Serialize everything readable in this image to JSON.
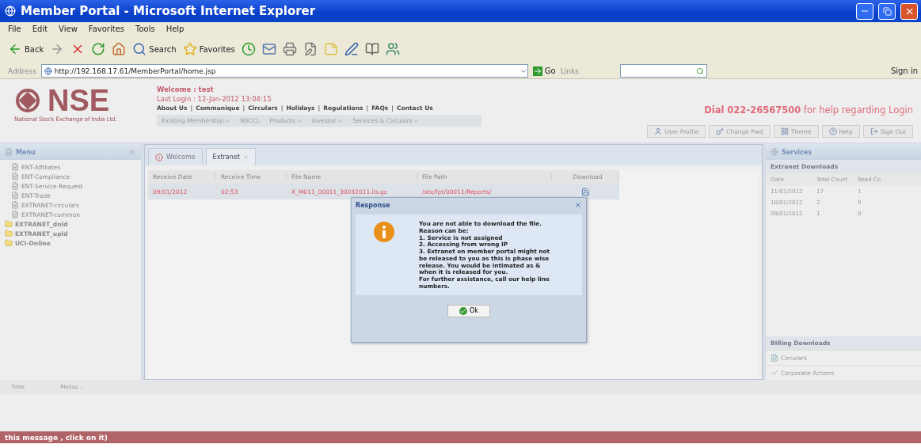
{
  "window": {
    "title": "Member Portal - Microsoft Internet Explorer"
  },
  "menu_bar": [
    "File",
    "Edit",
    "View",
    "Favorites",
    "Tools",
    "Help"
  ],
  "toolbar": [
    {
      "kind": "back",
      "label": "Back"
    },
    {
      "kind": "forward"
    },
    {
      "kind": "stop"
    },
    {
      "kind": "refresh"
    },
    {
      "kind": "home"
    },
    {
      "kind": "search",
      "label": "Search"
    },
    {
      "kind": "favorites",
      "label": "Favorites"
    },
    {
      "kind": "history"
    },
    {
      "kind": "mail"
    },
    {
      "kind": "print"
    },
    {
      "kind": "edit"
    },
    {
      "kind": "note"
    },
    {
      "kind": "pen"
    },
    {
      "kind": "research"
    },
    {
      "kind": "messenger"
    }
  ],
  "address_bar": {
    "label": "Address",
    "value": "http://192.168.17.61/MemberPortal/home.jsp",
    "go": "Go",
    "links": "Links",
    "sign_in": "Sign in"
  },
  "header": {
    "logo": "NSE",
    "logo_subtitle": "National Stock Exchange of India Ltd.",
    "welcome": "Welcome : test",
    "last_login": "Last Login : 12-Jan-2012 13:04:15",
    "link_separator": "|",
    "links": [
      "About Us",
      "Communique",
      "Circulars",
      "Holidays",
      "Regulations",
      "FAQs",
      "Contact Us"
    ],
    "nav": [
      {
        "label": "Existing Membership",
        "dropdown": true
      },
      {
        "label": "NSCCL",
        "dropdown": false
      },
      {
        "label": "Products",
        "dropdown": true
      },
      {
        "label": "Investor",
        "dropdown": true
      },
      {
        "label": "Services & Circulars",
        "dropdown": true
      }
    ],
    "helpline": {
      "strong": "Dial 022-26567500",
      "rest": "for help regarding Login"
    },
    "buttons": [
      {
        "kind": "user",
        "label": "User Profile"
      },
      {
        "kind": "key",
        "label": "Change Pwd"
      },
      {
        "kind": "theme",
        "label": "Theme"
      },
      {
        "kind": "help",
        "label": "Help"
      },
      {
        "kind": "signout",
        "label": "Sign Out"
      }
    ]
  },
  "sidebar": {
    "title": "Menu",
    "items": [
      {
        "kind": "page",
        "label": "ENT-Affiliates"
      },
      {
        "kind": "page",
        "label": "ENT-Compliance"
      },
      {
        "kind": "page",
        "label": "ENT-Service Request"
      },
      {
        "kind": "page",
        "label": "ENT-Trade"
      },
      {
        "kind": "page",
        "label": "EXTRANET-circulars"
      },
      {
        "kind": "page",
        "label": "EXTRANET-common"
      },
      {
        "kind": "folder",
        "label": "EXTRANET_dnld"
      },
      {
        "kind": "folder",
        "label": "EXTRANET_upld"
      },
      {
        "kind": "folder",
        "label": "UCI-Online"
      }
    ]
  },
  "tabs": [
    {
      "label": "Welcome",
      "selected": false,
      "closable": false
    },
    {
      "label": "Extranet",
      "selected": true,
      "closable": true
    }
  ],
  "table": {
    "columns": [
      "Receive Date",
      "Receive Time",
      "File Name",
      "File Path",
      "Download"
    ],
    "rows": [
      {
        "selected": true,
        "cells": [
          "09/01/2012",
          "02:53",
          "X_M011_00011_30032011.lis.gz",
          "/xtx/fpt/00011/Reports/"
        ]
      }
    ]
  },
  "dialog": {
    "title": "Response",
    "lines": [
      "You are not able to download the file.",
      "Reason can be:",
      "1. Service is not assigned",
      "2. Accessing from wrong IP",
      "3. Extranet on member portal might not be released to you as this is phase wise release. You would be intimated as & when it is released for you.",
      "For further assistance, call our help line numbers."
    ],
    "button": "Ok"
  },
  "services": {
    "title": "Services",
    "extranet": {
      "title": "Extranet Downloads",
      "columns": [
        "Date",
        "Total Count",
        "Read Co..."
      ],
      "rows": [
        [
          "11/01/2012",
          "17",
          "1"
        ],
        [
          "10/01/2012",
          "2",
          "0"
        ],
        [
          "09/01/2012",
          "1",
          "0"
        ]
      ]
    },
    "billing": "Billing Downloads",
    "items": [
      {
        "kind": "page",
        "label": "Circulars"
      },
      {
        "kind": "check",
        "label": "Corporate Actions"
      }
    ]
  },
  "log": {
    "columns": [
      "Time",
      "Messa..."
    ]
  },
  "ticker": "this message , click on it)"
}
